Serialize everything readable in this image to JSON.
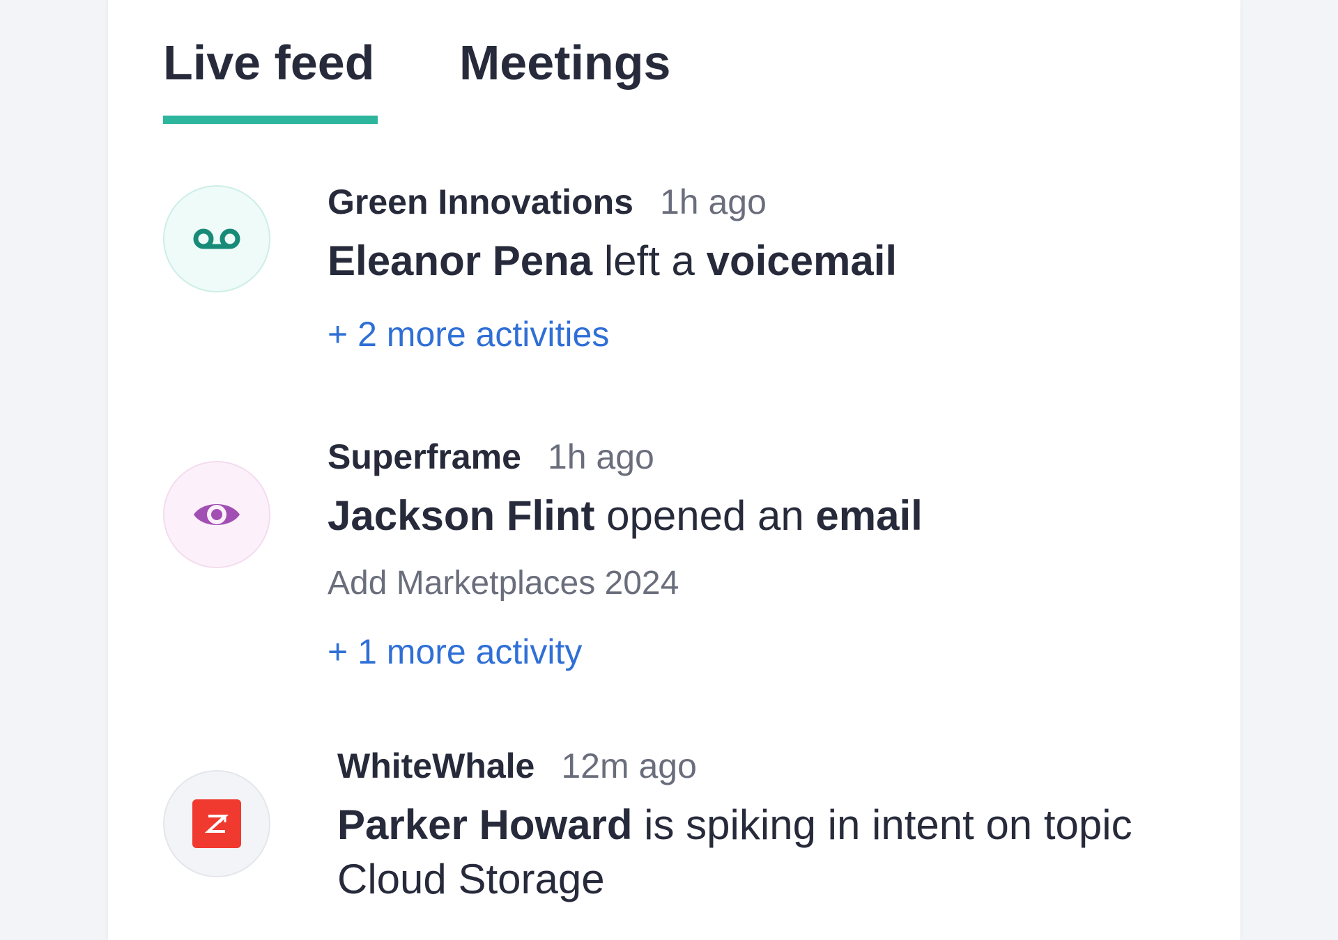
{
  "tabs": {
    "live_feed": "Live feed",
    "meetings": "Meetings",
    "active": "live_feed"
  },
  "colors": {
    "tab_underline": "#2db59d",
    "link": "#2f6fd6",
    "voicemail_icon": "#188a78",
    "eye_icon": "#a24fb4",
    "zoominfo_badge": "#f0392f"
  },
  "feed": {
    "items": [
      {
        "icon": "voicemail-icon",
        "company": "Green Innovations",
        "time": "1h ago",
        "actor": "Eleanor Pena",
        "action": " left a ",
        "object": "voicemail",
        "more": "+ 2 more activities"
      },
      {
        "icon": "eye-icon",
        "company": "Superframe",
        "time": "1h ago",
        "actor": "Jackson Flint",
        "action": " opened an ",
        "object": "email",
        "subtitle": "Add Marketplaces 2024",
        "more": "+ 1 more activity"
      },
      {
        "icon": "zoominfo-icon",
        "company": "WhiteWhale",
        "time": "12m ago",
        "actor": "Parker Howard",
        "action": " is spiking in intent on topic Cloud Storage"
      }
    ]
  }
}
